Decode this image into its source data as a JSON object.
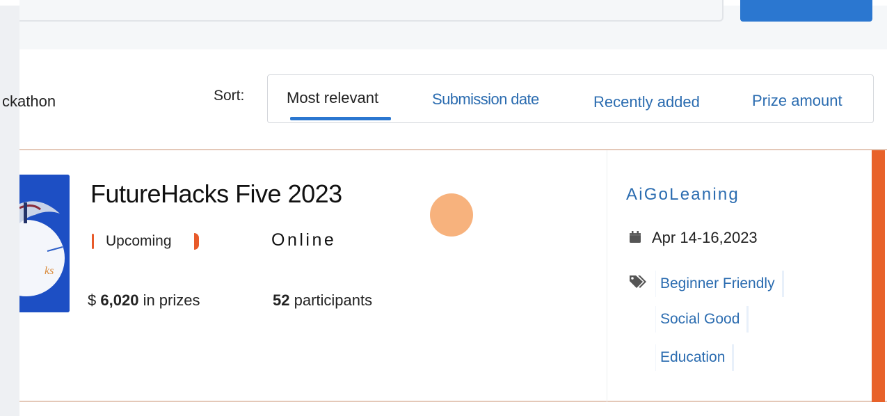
{
  "search": {
    "button_label": ""
  },
  "results": {
    "label": "ckathon"
  },
  "sort": {
    "label": "Sort:",
    "tabs": [
      {
        "label": "Most relevant",
        "active": true
      },
      {
        "label": "Submission date",
        "active": false
      },
      {
        "label": "Recently added",
        "active": false
      },
      {
        "label": "Prize amount",
        "active": false
      }
    ]
  },
  "card": {
    "title": "FutureHacks Five 2023",
    "status": "Upcoming",
    "location": "Online",
    "prize_currency": "$",
    "prize_amount": "6,020",
    "prize_suffix": "in prizes",
    "participants_count": "52",
    "participants_suffix": "participants",
    "host": "AiGoLeaning",
    "date": "Apr 14-16,2023",
    "tags": [
      "Beginner Friendly",
      "Social Good",
      "Education"
    ],
    "thumbnail_text": "ks",
    "icons": {
      "date": "calendar-icon",
      "tags": "tag-icon"
    },
    "colors": {
      "accent": "#e8622a",
      "link": "#2b6cb0",
      "status_dot": "#f7b27d"
    }
  }
}
